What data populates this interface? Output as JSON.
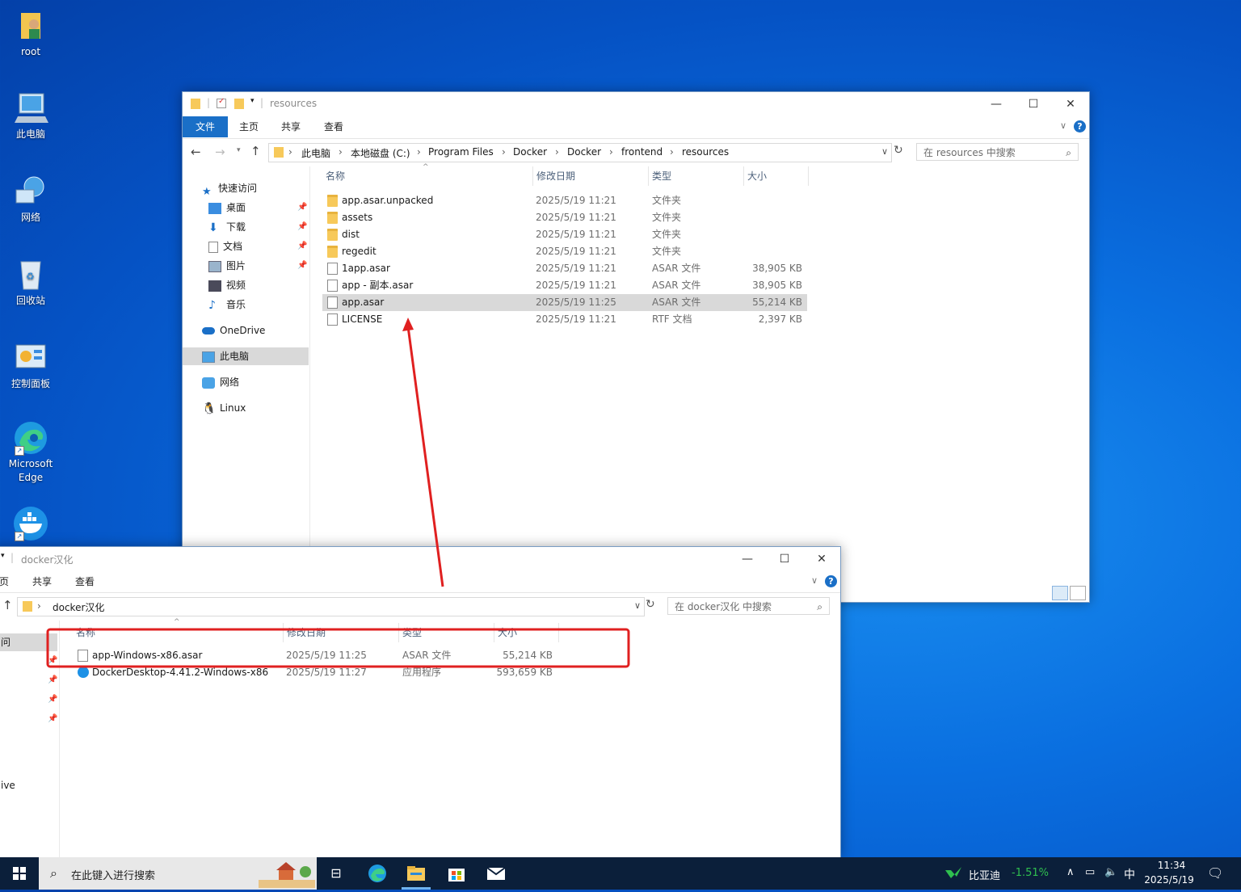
{
  "desktop": {
    "icons": [
      {
        "label": "root",
        "icon": "user-folder-icon"
      },
      {
        "label": "此电脑",
        "icon": "computer-icon"
      },
      {
        "label": "网络",
        "icon": "network-icon"
      },
      {
        "label": "回收站",
        "icon": "recycle-bin-icon"
      },
      {
        "label": "控制面板",
        "icon": "control-panel-icon"
      },
      {
        "label": "Microsoft Edge",
        "icon": "edge-icon"
      },
      {
        "label": "",
        "icon": "docker-icon"
      }
    ]
  },
  "window1": {
    "title": "resources",
    "ribbon_tabs": [
      "文件",
      "主页",
      "共享",
      "查看"
    ],
    "breadcrumb": [
      "此电脑",
      "本地磁盘 (C:)",
      "Program Files",
      "Docker",
      "Docker",
      "frontend",
      "resources"
    ],
    "search_placeholder": "在 resources 中搜索",
    "nav": {
      "quick_access": "快速访问",
      "quick_items": [
        "桌面",
        "下载",
        "文档",
        "图片",
        "视频",
        "音乐"
      ],
      "onedrive": "OneDrive",
      "this_pc": "此电脑",
      "network": "网络",
      "linux": "Linux"
    },
    "columns": [
      "名称",
      "修改日期",
      "类型",
      "大小"
    ],
    "files": [
      {
        "name": "app.asar.unpacked",
        "date": "2025/5/19 11:21",
        "type": "文件夹",
        "size": "",
        "kind": "folder"
      },
      {
        "name": "assets",
        "date": "2025/5/19 11:21",
        "type": "文件夹",
        "size": "",
        "kind": "folder"
      },
      {
        "name": "dist",
        "date": "2025/5/19 11:21",
        "type": "文件夹",
        "size": "",
        "kind": "folder"
      },
      {
        "name": "regedit",
        "date": "2025/5/19 11:21",
        "type": "文件夹",
        "size": "",
        "kind": "folder"
      },
      {
        "name": "1app.asar",
        "date": "2025/5/19 11:21",
        "type": "ASAR 文件",
        "size": "38,905 KB",
        "kind": "file"
      },
      {
        "name": "app - 副本.asar",
        "date": "2025/5/19 11:21",
        "type": "ASAR 文件",
        "size": "38,905 KB",
        "kind": "file"
      },
      {
        "name": "app.asar",
        "date": "2025/5/19 11:25",
        "type": "ASAR 文件",
        "size": "55,214 KB",
        "kind": "file"
      },
      {
        "name": "LICENSE",
        "date": "2025/5/19 11:21",
        "type": "RTF 文档",
        "size": "2,397 KB",
        "kind": "file"
      }
    ]
  },
  "window2": {
    "title": "docker汉化",
    "ribbon_tabs": [
      "页",
      "共享",
      "查看"
    ],
    "breadcrumb": [
      "docker汉化"
    ],
    "search_placeholder": "在 docker汉化 中搜索",
    "nav": {
      "partial1": "问",
      "partial2": "ive"
    },
    "columns": [
      "名称",
      "修改日期",
      "类型",
      "大小"
    ],
    "files": [
      {
        "name": "app-Windows-x86.asar",
        "date": "2025/5/19 11:25",
        "type": "ASAR 文件",
        "size": "55,214 KB",
        "kind": "file"
      },
      {
        "name": "DockerDesktop-4.41.2-Windows-x86",
        "date": "2025/5/19 11:27",
        "type": "应用程序",
        "size": "593,659 KB",
        "kind": "app"
      }
    ]
  },
  "taskbar": {
    "search_placeholder": "在此键入进行搜索",
    "stock_name": "比亚迪",
    "stock_change": "-1.51%",
    "ime": "中",
    "time": "11:34",
    "date": "2025/5/19"
  },
  "colors": {
    "accent": "#1a6fc7",
    "annotation": "#e02020",
    "stock_up": "#2fbf4f"
  }
}
